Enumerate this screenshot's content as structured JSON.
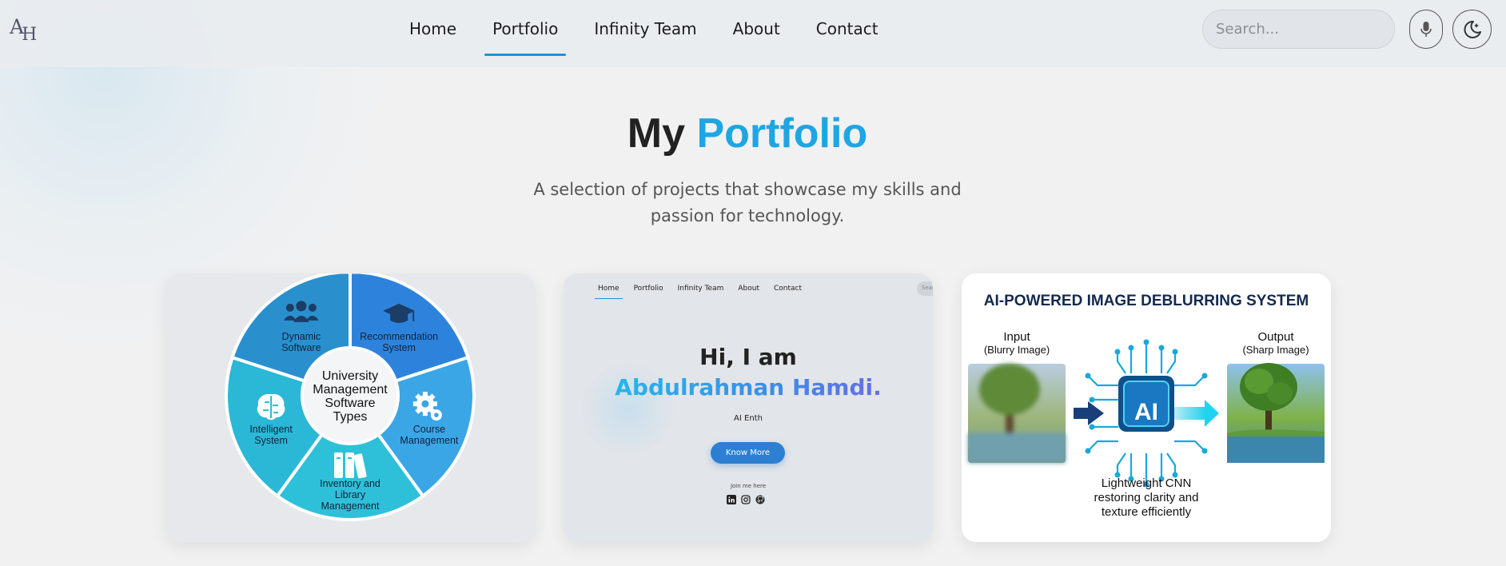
{
  "nav": {
    "logo_main": "A",
    "logo_sub": "H",
    "links": [
      "Home",
      "Portfolio",
      "Infinity Team",
      "About",
      "Contact"
    ],
    "active_link": "Portfolio",
    "search_placeholder": "Search..."
  },
  "hero": {
    "title_part1": "My",
    "title_part2": "Portfolio",
    "subtitle": "A selection of projects that showcase my skills and passion for technology."
  },
  "cards": {
    "card1": {
      "center": [
        "University",
        "Management",
        "Software",
        "Types"
      ],
      "segments": [
        {
          "label": [
            "Recommendation",
            "System"
          ],
          "icon": "graduation-cap-icon"
        },
        {
          "label": [
            "Course",
            "Management"
          ],
          "icon": "gears-icon"
        },
        {
          "label": [
            "Inventory and",
            "Library",
            "Management"
          ],
          "icon": "books-icon"
        },
        {
          "label": [
            "Intelligent",
            "System"
          ],
          "icon": "brain-icon"
        },
        {
          "label": [
            "Dynamic",
            "Software"
          ],
          "icon": "users-icon"
        }
      ],
      "colors": [
        "#2d83dc",
        "#3aa6e6",
        "#2fc0d9",
        "#2bb7d6",
        "#2a90cd"
      ]
    },
    "card2": {
      "nav": [
        "Home",
        "Portfolio",
        "Infinity Team",
        "About",
        "Contact"
      ],
      "search": "Sear",
      "greeting": "Hi, I am",
      "name": "Abdulrahman Hamdi.",
      "role": "AI Enth",
      "button": "Know More",
      "join": "Join me here"
    },
    "card3": {
      "title": "AI-POWERED IMAGE DEBLURRING SYSTEM",
      "input_label": "Input",
      "input_sub": "(Blurry Image)",
      "output_label": "Output",
      "output_sub": "(Sharp Image)",
      "chip_text": "AI",
      "caption": [
        "Lightweight CNN",
        "restoring clarity and",
        "texture efficiently"
      ]
    }
  },
  "colors": {
    "accent": "#1ea6e4",
    "nav_underline": "#1a95d8",
    "button": "#2d7fd1"
  }
}
